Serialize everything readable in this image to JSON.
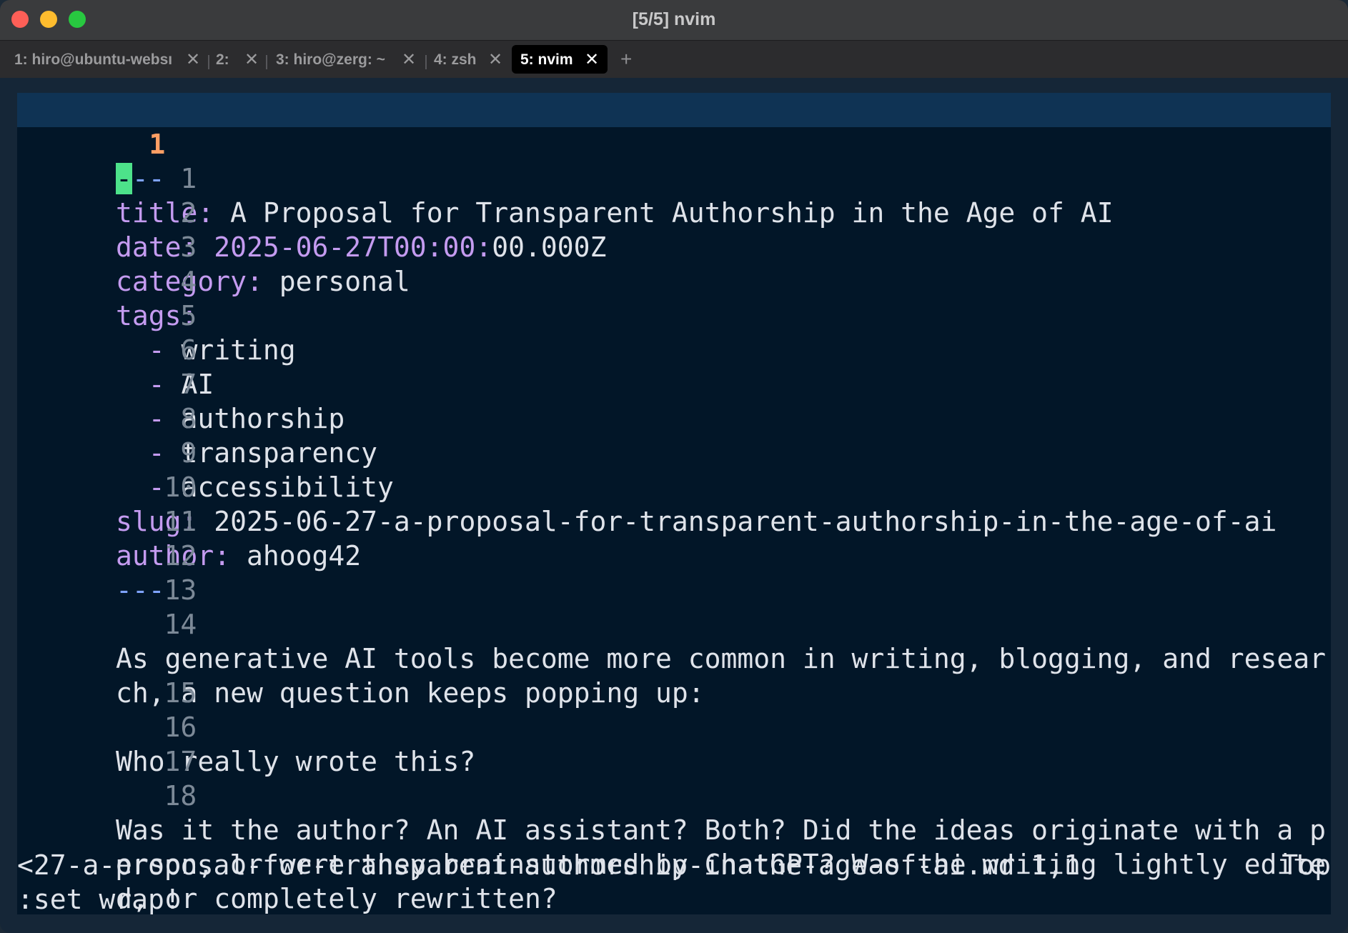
{
  "window": {
    "title": "[5/5] nvim"
  },
  "tabs": [
    {
      "label": "1: hiro@ubuntu-websı",
      "close": "✕"
    },
    {
      "label": "2:",
      "close": "✕"
    },
    {
      "label": "3: hiro@zerg: ~",
      "close": "✕"
    },
    {
      "label": "4: zsh",
      "close": "✕"
    },
    {
      "label": "5: nvim",
      "close": "✕"
    }
  ],
  "new_tab": "+",
  "editor": {
    "current_line_number": "1",
    "lines": [
      {
        "n": "1",
        "key": "title:",
        "val": " A Proposal for Transparent Authorship in the Age of AI"
      },
      {
        "n": "2",
        "key": "date:",
        "num": " 2025-06-27T00:00:",
        "val": "00.000Z"
      },
      {
        "n": "3",
        "key": "category:",
        "val": " personal"
      },
      {
        "n": "4",
        "key": "tags:",
        "val": ""
      },
      {
        "n": "5",
        "dash": "  -",
        "val": " writing"
      },
      {
        "n": "6",
        "dash": "  -",
        "val": " AI"
      },
      {
        "n": "7",
        "dash": "  -",
        "val": " authorship"
      },
      {
        "n": "8",
        "dash": "  -",
        "val": " transparency"
      },
      {
        "n": "9",
        "dash": "  -",
        "val": " accessibility"
      },
      {
        "n": "10",
        "key": "slug:",
        "val": " 2025-06-27-a-proposal-for-transparent-authorship-in-the-age-of-ai"
      },
      {
        "n": "11",
        "key": "author:",
        "val": " ahoog42"
      },
      {
        "n": "12",
        "fm": "---"
      },
      {
        "n": "13",
        "val": ""
      },
      {
        "n": "14",
        "val": "As generative AI tools become more common in writing, blogging, and resear"
      },
      {
        "n": "",
        "val": "ch, a new question keeps popping up:"
      },
      {
        "n": "15",
        "val": ""
      },
      {
        "n": "16",
        "val": "Who really wrote this?"
      },
      {
        "n": "17",
        "val": ""
      },
      {
        "n": "18",
        "val": "Was it the author? An AI assistant? Both? Did the ideas originate with a p"
      },
      {
        "n": "",
        "val": "erson, or were they brainstormed by ChatGPT? Was the writing lightly edite"
      },
      {
        "n": "",
        "val": "d, or completely rewritten?"
      }
    ],
    "first_line": {
      "cursor_char": "-",
      "rest": "--"
    }
  },
  "statusline": {
    "file": "<27-a-proposal-for-transparent-authorship-in-the-age-of-ai.md",
    "position": "1,1",
    "scroll": "Top"
  },
  "cmdline": ":set wrap!"
}
